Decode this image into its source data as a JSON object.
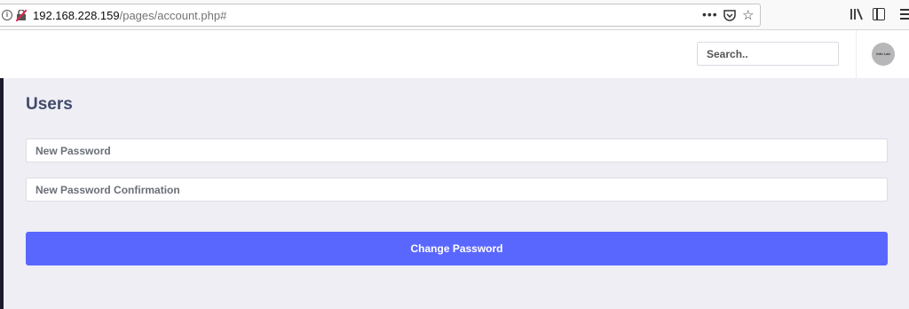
{
  "browser": {
    "url_host": "192.168.228.159",
    "url_path": "/pages/account.php#",
    "page_actions": "•••"
  },
  "header": {
    "search_placeholder": "Search..",
    "avatar_text": "Info Lab"
  },
  "main": {
    "title": "Users",
    "new_password_placeholder": "New Password",
    "confirm_password_placeholder": "New Password Confirmation",
    "submit_label": "Change Password"
  },
  "colors": {
    "accent": "#5a67ff",
    "background": "#eeeef4",
    "title": "#414a6b",
    "sidebar_edge": "#1c1b2e"
  },
  "icons": [
    "info-icon",
    "broken-lock-icon",
    "page-actions-icon",
    "pocket-icon",
    "star-icon",
    "library-icon",
    "sidebar-icon",
    "menu-icon"
  ]
}
